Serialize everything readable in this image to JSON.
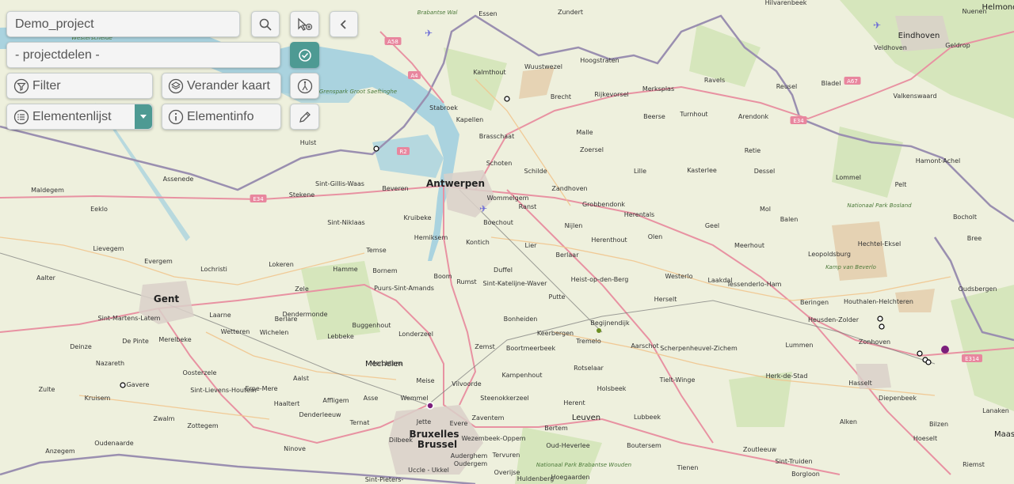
{
  "project": {
    "value": "Demo_project"
  },
  "projectdelen": {
    "value": "- projectdelen -"
  },
  "buttons": {
    "filter": "Filter",
    "verander_kaart": "Verander kaart",
    "elementenlijst": "Elementenlijst",
    "elementinfo": "Elementinfo"
  },
  "colors": {
    "accent": "#4e9a93",
    "panel": "#f4f4f4",
    "marker_purple": "#7b1e7b"
  },
  "map": {
    "places": [
      {
        "name": "Antwerpen",
        "cls": "big"
      },
      {
        "name": "Gent",
        "cls": "big"
      },
      {
        "name": "Bruxelles",
        "cls": "big"
      },
      {
        "name": "Brussel",
        "cls": "big"
      },
      {
        "name": "Eindhoven",
        "cls": "mid"
      },
      {
        "name": "Leuven",
        "cls": "mid"
      },
      {
        "name": "Mechelen",
        "cls": "mid"
      },
      {
        "name": "Helmond",
        "cls": "mid"
      },
      {
        "name": "Essen",
        "cls": ""
      },
      {
        "name": "Zundert",
        "cls": ""
      },
      {
        "name": "Hilvarenbeek",
        "cls": ""
      },
      {
        "name": "Nuenen",
        "cls": ""
      },
      {
        "name": "Kalmthout",
        "cls": ""
      },
      {
        "name": "Wuustwezel",
        "cls": ""
      },
      {
        "name": "Hoogstraten",
        "cls": ""
      },
      {
        "name": "Veldhoven",
        "cls": ""
      },
      {
        "name": "Geldrop",
        "cls": ""
      },
      {
        "name": "Ravels",
        "cls": ""
      },
      {
        "name": "Reusel",
        "cls": ""
      },
      {
        "name": "Bladel",
        "cls": ""
      },
      {
        "name": "Brecht",
        "cls": ""
      },
      {
        "name": "Rijkevorsel",
        "cls": ""
      },
      {
        "name": "Merksplas",
        "cls": ""
      },
      {
        "name": "Turnhout",
        "cls": ""
      },
      {
        "name": "Arendonk",
        "cls": ""
      },
      {
        "name": "Valkenswaard",
        "cls": ""
      },
      {
        "name": "Stabroek",
        "cls": ""
      },
      {
        "name": "Kapellen",
        "cls": ""
      },
      {
        "name": "Brasschaat",
        "cls": ""
      },
      {
        "name": "Malle",
        "cls": ""
      },
      {
        "name": "Beerse",
        "cls": ""
      },
      {
        "name": "Hulst",
        "cls": ""
      },
      {
        "name": "Schoten",
        "cls": ""
      },
      {
        "name": "Zoersel",
        "cls": ""
      },
      {
        "name": "Retie",
        "cls": ""
      },
      {
        "name": "Hamont-Achel",
        "cls": ""
      },
      {
        "name": "Schilde",
        "cls": ""
      },
      {
        "name": "Lille",
        "cls": ""
      },
      {
        "name": "Kasterlee",
        "cls": ""
      },
      {
        "name": "Dessel",
        "cls": ""
      },
      {
        "name": "Lommel",
        "cls": ""
      },
      {
        "name": "Pelt",
        "cls": ""
      },
      {
        "name": "Assenede",
        "cls": ""
      },
      {
        "name": "Sint-Gillis-Waas",
        "cls": ""
      },
      {
        "name": "Beveren",
        "cls": ""
      },
      {
        "name": "Wommelgem",
        "cls": ""
      },
      {
        "name": "Zandhoven",
        "cls": ""
      },
      {
        "name": "Maldegem",
        "cls": ""
      },
      {
        "name": "Stekene",
        "cls": ""
      },
      {
        "name": "Ranst",
        "cls": ""
      },
      {
        "name": "Grobbendonk",
        "cls": ""
      },
      {
        "name": "Herentals",
        "cls": ""
      },
      {
        "name": "Mol",
        "cls": ""
      },
      {
        "name": "Balen",
        "cls": ""
      },
      {
        "name": "Eeklo",
        "cls": ""
      },
      {
        "name": "Kruibeke",
        "cls": ""
      },
      {
        "name": "Sint-Niklaas",
        "cls": ""
      },
      {
        "name": "Boechout",
        "cls": ""
      },
      {
        "name": "Nijlen",
        "cls": ""
      },
      {
        "name": "Geel",
        "cls": ""
      },
      {
        "name": "Bocholt",
        "cls": ""
      },
      {
        "name": "Hemiksem",
        "cls": ""
      },
      {
        "name": "Herenthout",
        "cls": ""
      },
      {
        "name": "Olen",
        "cls": ""
      },
      {
        "name": "Bree",
        "cls": ""
      },
      {
        "name": "Lievegem",
        "cls": ""
      },
      {
        "name": "Kontich",
        "cls": ""
      },
      {
        "name": "Meerhout",
        "cls": ""
      },
      {
        "name": "Hechtel-Eksel",
        "cls": ""
      },
      {
        "name": "Temse",
        "cls": ""
      },
      {
        "name": "Lier",
        "cls": ""
      },
      {
        "name": "Berlaar",
        "cls": ""
      },
      {
        "name": "Leopoldsburg",
        "cls": ""
      },
      {
        "name": "Evergem",
        "cls": ""
      },
      {
        "name": "Lochristi",
        "cls": ""
      },
      {
        "name": "Lokeren",
        "cls": ""
      },
      {
        "name": "Hamme",
        "cls": ""
      },
      {
        "name": "Bornem",
        "cls": ""
      },
      {
        "name": "Duffel",
        "cls": ""
      },
      {
        "name": "Aalter",
        "cls": ""
      },
      {
        "name": "Boom",
        "cls": ""
      },
      {
        "name": "Heist-op-den-Berg",
        "cls": ""
      },
      {
        "name": "Westerlo",
        "cls": ""
      },
      {
        "name": "Laakdal",
        "cls": ""
      },
      {
        "name": "Tessenderlo-Ham",
        "cls": ""
      },
      {
        "name": "Oudsbergen",
        "cls": ""
      },
      {
        "name": "Zele",
        "cls": ""
      },
      {
        "name": "Puurs-Sint-Amands",
        "cls": ""
      },
      {
        "name": "Rumst",
        "cls": ""
      },
      {
        "name": "Sint-Katelijne-Waver",
        "cls": ""
      },
      {
        "name": "Putte",
        "cls": ""
      },
      {
        "name": "Houthalen-Helchteren",
        "cls": ""
      },
      {
        "name": "Herselt",
        "cls": ""
      },
      {
        "name": "Beringen",
        "cls": ""
      },
      {
        "name": "Laarne",
        "cls": ""
      },
      {
        "name": "Berlare",
        "cls": ""
      },
      {
        "name": "Dendermonde",
        "cls": ""
      },
      {
        "name": "Sint-Martens-Latem",
        "cls": ""
      },
      {
        "name": "Merelbeke",
        "cls": ""
      },
      {
        "name": "Heusden-Zolder",
        "cls": ""
      },
      {
        "name": "Bonheiden",
        "cls": ""
      },
      {
        "name": "Begijnendijk",
        "cls": ""
      },
      {
        "name": "Wetteren",
        "cls": ""
      },
      {
        "name": "Wichelen",
        "cls": ""
      },
      {
        "name": "Buggenhout",
        "cls": ""
      },
      {
        "name": "Zonhoven",
        "cls": ""
      },
      {
        "name": "De Pinte",
        "cls": ""
      },
      {
        "name": "Lebbeke",
        "cls": ""
      },
      {
        "name": "Londerzeel",
        "cls": ""
      },
      {
        "name": "Keerbergen",
        "cls": ""
      },
      {
        "name": "Tremelo",
        "cls": ""
      },
      {
        "name": "Scherpenheuvel-Zichem",
        "cls": ""
      },
      {
        "name": "Lummen",
        "cls": ""
      },
      {
        "name": "Deinze",
        "cls": ""
      },
      {
        "name": "Zemst",
        "cls": ""
      },
      {
        "name": "Boortmeerbeek",
        "cls": ""
      },
      {
        "name": "Aarschot",
        "cls": ""
      },
      {
        "name": "Nazareth",
        "cls": ""
      },
      {
        "name": "Merchtem",
        "cls": ""
      },
      {
        "name": "Oosterzele",
        "cls": ""
      },
      {
        "name": "Rotselaar",
        "cls": ""
      },
      {
        "name": "Kampenhout",
        "cls": ""
      },
      {
        "name": "Herk-de-Stad",
        "cls": ""
      },
      {
        "name": "Aalst",
        "cls": ""
      },
      {
        "name": "Tielt-Winge",
        "cls": ""
      },
      {
        "name": "Meise",
        "cls": ""
      },
      {
        "name": "Vilvoorde",
        "cls": ""
      },
      {
        "name": "Hasselt",
        "cls": ""
      },
      {
        "name": "Gavere",
        "cls": ""
      },
      {
        "name": "Sint-Lievens-Houtem",
        "cls": ""
      },
      {
        "name": "Erpe-Mere",
        "cls": ""
      },
      {
        "name": "Holsbeek",
        "cls": ""
      },
      {
        "name": "Zulte",
        "cls": ""
      },
      {
        "name": "Asse",
        "cls": ""
      },
      {
        "name": "Steenokkerzeel",
        "cls": ""
      },
      {
        "name": "Diepenbeek",
        "cls": ""
      },
      {
        "name": "Kruisem",
        "cls": ""
      },
      {
        "name": "Haaltert",
        "cls": ""
      },
      {
        "name": "Affligem",
        "cls": ""
      },
      {
        "name": "Wemmel",
        "cls": ""
      },
      {
        "name": "Herent",
        "cls": ""
      },
      {
        "name": "Lanaken",
        "cls": ""
      },
      {
        "name": "Zottegem",
        "cls": ""
      },
      {
        "name": "Denderleeuw",
        "cls": ""
      },
      {
        "name": "Jette",
        "cls": ""
      },
      {
        "name": "Evere",
        "cls": ""
      },
      {
        "name": "Zaventem",
        "cls": ""
      },
      {
        "name": "Lubbeek",
        "cls": ""
      },
      {
        "name": "Zwalm",
        "cls": ""
      },
      {
        "name": "Ternat",
        "cls": ""
      },
      {
        "name": "Bertem",
        "cls": ""
      },
      {
        "name": "Alken",
        "cls": ""
      },
      {
        "name": "Bilzen",
        "cls": ""
      },
      {
        "name": "Oudenaarde",
        "cls": ""
      },
      {
        "name": "Dilbeek",
        "cls": ""
      },
      {
        "name": "Wezembeek-Oppem",
        "cls": ""
      },
      {
        "name": "Oud-Heverlee",
        "cls": ""
      },
      {
        "name": "Boutersem",
        "cls": ""
      },
      {
        "name": "Hoeselt",
        "cls": ""
      },
      {
        "name": "Anzegem",
        "cls": ""
      },
      {
        "name": "Ninove",
        "cls": ""
      },
      {
        "name": "Auderghem",
        "cls": ""
      },
      {
        "name": "Oudergem",
        "cls": ""
      },
      {
        "name": "Tervuren",
        "cls": ""
      },
      {
        "name": "Zoutleeuw",
        "cls": ""
      },
      {
        "name": "Uccle - Ukkel",
        "cls": ""
      },
      {
        "name": "Overijse",
        "cls": ""
      },
      {
        "name": "Tienen",
        "cls": ""
      },
      {
        "name": "Sint-Truiden",
        "cls": ""
      },
      {
        "name": "Riemst",
        "cls": ""
      },
      {
        "name": "Hoegaarden",
        "cls": ""
      },
      {
        "name": "Borgloon",
        "cls": ""
      },
      {
        "name": "Maas",
        "cls": "mid"
      },
      {
        "name": "Huldenberg",
        "cls": ""
      },
      {
        "name": "Sint-Pieters-",
        "cls": ""
      }
    ],
    "area_labels": [
      "Westerschelde",
      "Brabantse Wal",
      "Grenspark Groot Saeftinghe",
      "Nationaal Park Bosland",
      "Kamp van Beverlo",
      "Nationaal Park Brabantse Wouden"
    ],
    "roads": [
      "A58",
      "A4",
      "R2",
      "E34",
      "E34",
      "A67",
      "E314"
    ]
  }
}
